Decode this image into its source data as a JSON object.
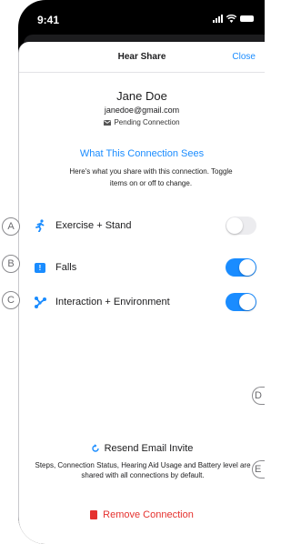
{
  "status_bar": {
    "time": "9:41"
  },
  "sheet": {
    "title": "Hear Share",
    "close_label": "Close"
  },
  "user": {
    "name": "Jane Doe",
    "email": "janedoe@gmail.com",
    "status": "Pending Connection"
  },
  "section": {
    "title": "What This Connection Sees",
    "description": "Here's what you share with this connection. Toggle items on or off to change."
  },
  "items": [
    {
      "label": "Exercise + Stand",
      "enabled": false,
      "icon": "running-figure-icon",
      "color": "#1a8cff"
    },
    {
      "label": "Falls",
      "enabled": true,
      "icon": "alert-square-icon",
      "color": "#1a8cff"
    },
    {
      "label": "Interaction + Environment",
      "enabled": true,
      "icon": "network-nodes-icon",
      "color": "#1a8cff"
    }
  ],
  "markers": [
    "A",
    "B",
    "C",
    "D",
    "E"
  ],
  "resend_label": "Resend Email Invite",
  "info_text": "Steps, Connection Status, Hearing Aid Usage and Battery level are shared with all connections by default.",
  "remove_label": "Remove Connection",
  "colors": {
    "accent": "#1a8cff",
    "destructive": "#e5312e"
  }
}
